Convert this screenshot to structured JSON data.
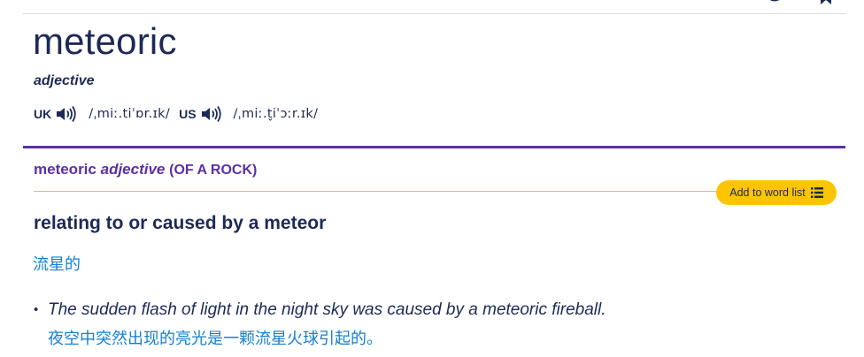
{
  "entry": {
    "headword": "meteoric",
    "part_of_speech": "adjective",
    "pronunciations": [
      {
        "region": "UK",
        "ipa": "/ˌmiː.tiˈɒr.ɪk/",
        "icon": "speaker-icon"
      },
      {
        "region": "US",
        "ipa": "/ˌmiː.t̬iˈɔːr.ɪk/",
        "icon": "speaker-icon"
      }
    ]
  },
  "sense": {
    "word": "meteoric",
    "pos": "adjective",
    "guideword": "(OF A ROCK)",
    "add_to_word_list": "Add to word list",
    "definition": "relating to or caused by a meteor",
    "translation": "流星的",
    "example": {
      "text": "The sudden flash of light in the night sky was caused by a meteoric fireball.",
      "translation": "夜空中突然出现的亮光是一颗流星火球引起的。"
    }
  },
  "colors": {
    "accent_purple": "#5b2fa8",
    "button_yellow": "#fcc500",
    "text_navy": "#1d2a57",
    "translation_blue": "#1580d0"
  },
  "icons": {
    "top_left": "eye-icon",
    "top_right": "bookmark-icon",
    "word_list": "list-icon"
  }
}
